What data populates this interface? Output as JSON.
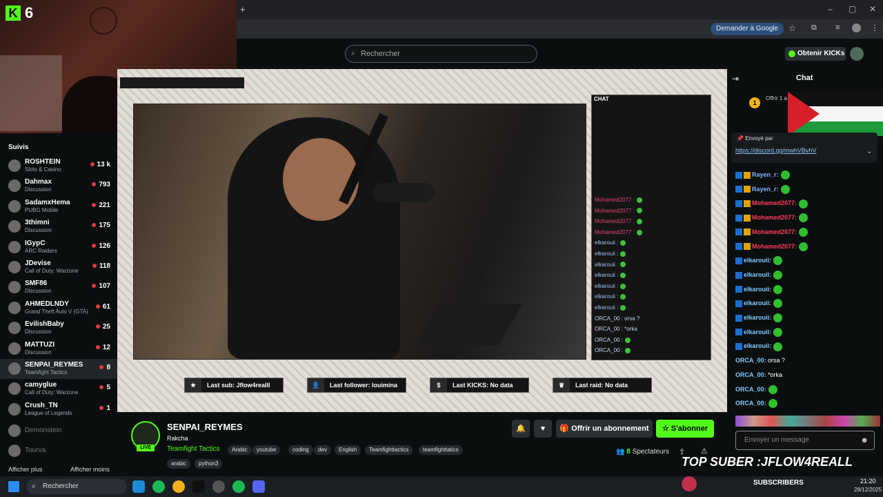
{
  "browser": {
    "google_button": "Demander à Google"
  },
  "header": {
    "search_placeholder": "Rechercher",
    "get_kicks": "Obtenir KICKs"
  },
  "webcam": {
    "badge_number": "6"
  },
  "sidebar": {
    "title": "Suivis",
    "channels": [
      {
        "name": "ROSHTEIN",
        "category": "Slots & Casino",
        "viewers": "13 k"
      },
      {
        "name": "Dahmax",
        "category": "Discussion",
        "viewers": "793"
      },
      {
        "name": "SadamxHema",
        "category": "PUBG Mobile",
        "viewers": "221"
      },
      {
        "name": "3thimni",
        "category": "Discussion",
        "viewers": "175"
      },
      {
        "name": "IGypC",
        "category": "ARC Raiders",
        "viewers": "126"
      },
      {
        "name": "JDevise",
        "category": "Call of Duty: Warzone",
        "viewers": "118"
      },
      {
        "name": "SMF86",
        "category": "Discussion",
        "viewers": "107"
      },
      {
        "name": "AHMEDLNDY",
        "category": "Grand Theft Auto V (GTA)",
        "viewers": "61"
      },
      {
        "name": "EvilishBaby",
        "category": "Discussion",
        "viewers": "25"
      },
      {
        "name": "MATTUZI",
        "category": "Discussion",
        "viewers": "12"
      },
      {
        "name": "SENPAI_REYMES",
        "category": "Teamfight Tactics",
        "viewers": "8"
      },
      {
        "name": "camyglue",
        "category": "Call of Duty: Warzone",
        "viewers": "5"
      },
      {
        "name": "Crush_TN",
        "category": "League of Legends",
        "viewers": "1"
      }
    ],
    "offline": [
      "Demonstein",
      "Tourva"
    ],
    "show_more": "Afficher plus",
    "show_less": "Afficher moins"
  },
  "stream_overlay": {
    "chat_title": "CHAT",
    "chat_lines": [
      {
        "user": "Mohamed2077 :",
        "style": "red"
      },
      {
        "user": "Mohamed2077 :",
        "style": "red"
      },
      {
        "user": "Mohamed2077 :",
        "style": "red"
      },
      {
        "user": "Mohamed2077 :",
        "style": "red"
      },
      {
        "user": "elkarouii :",
        "style": "blue"
      },
      {
        "user": "elkarouii :",
        "style": "blue"
      },
      {
        "user": "elkarouii :",
        "style": "blue"
      },
      {
        "user": "elkarouii :",
        "style": "blue"
      },
      {
        "user": "elkarouii :",
        "style": "blue"
      },
      {
        "user": "elkarouii :",
        "style": "blue"
      },
      {
        "user": "elkarouii :",
        "style": "blue"
      },
      {
        "user": "ORCA_00 :",
        "style": "plain",
        "text": "orsa ?"
      },
      {
        "user": "ORCA_00 :",
        "style": "plain",
        "text": "*orka"
      },
      {
        "user": "ORCA_00 :",
        "style": "plain"
      },
      {
        "user": "ORCA_00 :",
        "style": "plain"
      }
    ],
    "stats": [
      {
        "icon": "star-icon",
        "label": "Last sub: Jflow4realll"
      },
      {
        "icon": "user-icon",
        "label": "Last follower: louimina"
      },
      {
        "icon": "dollar-icon",
        "label": "Last KICKS: No data"
      },
      {
        "icon": "crown-icon",
        "label": "Last raid: No data"
      }
    ]
  },
  "stream_info": {
    "live_label": "LIVE",
    "streamer": "SENPAI_REYMES",
    "title": "Rakcha",
    "category": "Teamfight Tactics",
    "tags": [
      "Arabic",
      "youtube",
      "coding",
      "dev",
      "English",
      "Teamfighttactics",
      "teamfighttatics",
      "arabic",
      "python3"
    ],
    "gift_button": "Offrir un abonnement",
    "subscribe_button": "S'abonner",
    "viewers_count": "8",
    "viewers_label": "Spectateurs"
  },
  "chat": {
    "title": "Chat",
    "gift_promo": "Offrir 1 a 1ère",
    "pinned_by": "Envoyé par",
    "pinned_link": "https://discord.gg/mwhVBvhV",
    "messages": [
      {
        "user": "Rayen_r:",
        "color": "blue",
        "text": ""
      },
      {
        "user": "Rayen_r:",
        "color": "blue",
        "text": ""
      },
      {
        "user": "Mohamed2077:",
        "color": "red",
        "text": ""
      },
      {
        "user": "Mohamed2077:",
        "color": "red",
        "text": ""
      },
      {
        "user": "Mohamed2077:",
        "color": "red",
        "text": ""
      },
      {
        "user": "Mohamed2077:",
        "color": "red",
        "text": ""
      },
      {
        "user": "elkarouii:",
        "color": "cyan",
        "text": ""
      },
      {
        "user": "elkarouii:",
        "color": "cyan",
        "text": ""
      },
      {
        "user": "elkarouii:",
        "color": "cyan",
        "text": ""
      },
      {
        "user": "elkarouii:",
        "color": "cyan",
        "text": ""
      },
      {
        "user": "elkarouii:",
        "color": "cyan",
        "text": ""
      },
      {
        "user": "elkarouii:",
        "color": "cyan",
        "text": ""
      },
      {
        "user": "elkarouii:",
        "color": "cyan",
        "text": ""
      },
      {
        "user": "ORCA_00:",
        "color": "cyan",
        "text": "orsa ?"
      },
      {
        "user": "ORCA_00:",
        "color": "cyan",
        "text": "*orka"
      },
      {
        "user": "ORCA_00:",
        "color": "cyan",
        "text": ""
      },
      {
        "user": "ORCA_00:",
        "color": "cyan",
        "text": ""
      }
    ],
    "input_placeholder": "Envoyer un message",
    "overlay_text": "TOP SUBER :JFLOW4REALL",
    "subscribers_label": "SUBSCRIBERS"
  },
  "taskbar": {
    "search": "Rechercher",
    "time": "21:20",
    "date": "28/12/2025"
  },
  "colors": {
    "accent": "#53fc18",
    "background": "#0b0e0f"
  }
}
